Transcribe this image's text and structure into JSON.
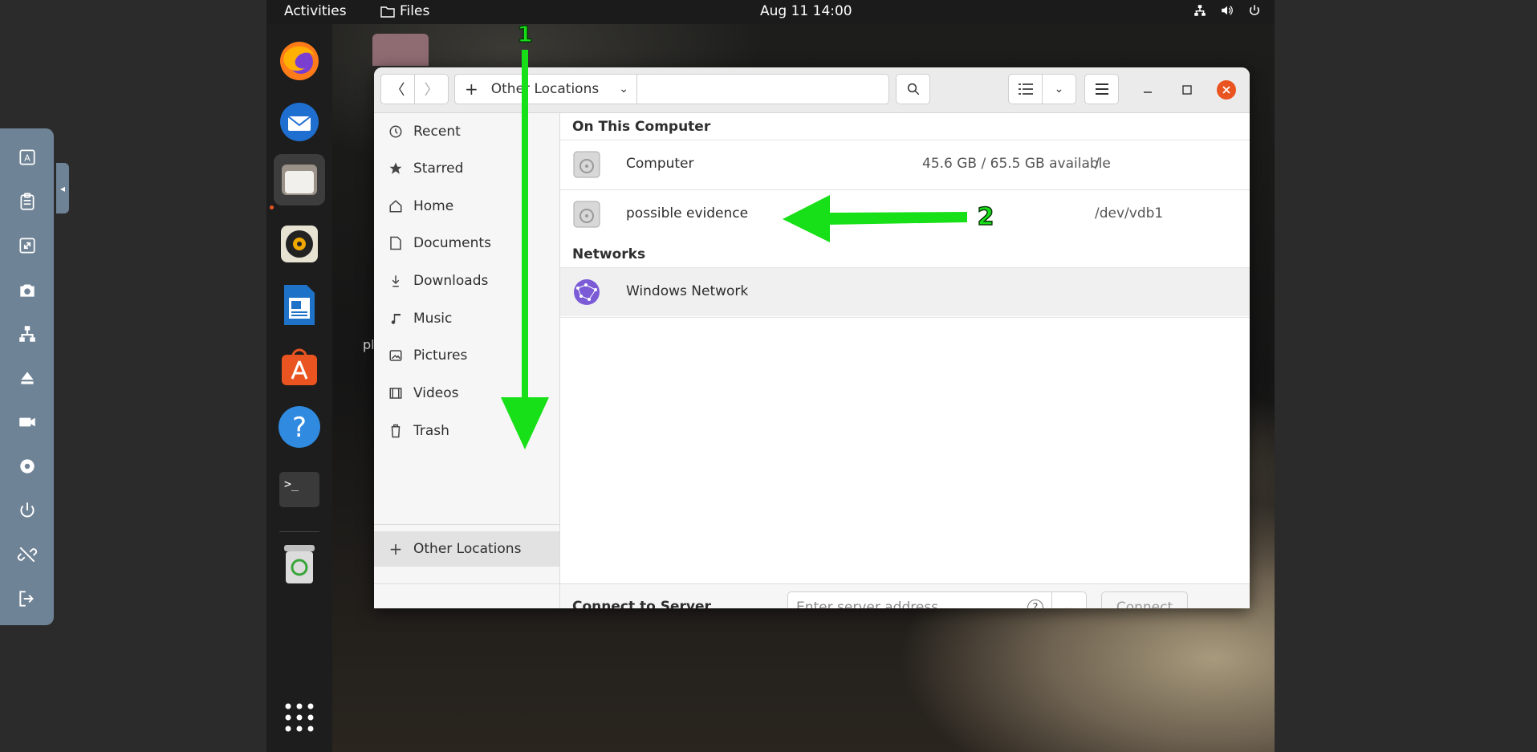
{
  "topbar": {
    "activities": "Activities",
    "app_name": "Files",
    "clock": "Aug 11  14:00"
  },
  "window": {
    "path_label": "Other Locations"
  },
  "sidebar": {
    "items": [
      {
        "label": "Recent",
        "icon": "clock-icon"
      },
      {
        "label": "Starred",
        "icon": "star-icon"
      },
      {
        "label": "Home",
        "icon": "home-icon"
      },
      {
        "label": "Documents",
        "icon": "document-icon"
      },
      {
        "label": "Downloads",
        "icon": "download-icon"
      },
      {
        "label": "Music",
        "icon": "music-icon"
      },
      {
        "label": "Pictures",
        "icon": "picture-icon"
      },
      {
        "label": "Videos",
        "icon": "video-icon"
      },
      {
        "label": "Trash",
        "icon": "trash-icon"
      }
    ],
    "other_locations": "Other Locations"
  },
  "content": {
    "on_this_computer": "On This Computer",
    "networks": "Networks",
    "locations": [
      {
        "name": "Computer",
        "available": "45.6 GB / 65.5 GB available",
        "mount": "/"
      },
      {
        "name": "possible evidence",
        "available": "",
        "mount": "/dev/vdb1"
      }
    ],
    "network_items": [
      {
        "name": "Windows Network"
      }
    ]
  },
  "footer": {
    "label": "Connect to Server",
    "placeholder": "Enter server address...",
    "help": "?",
    "connect": "Connect"
  },
  "annotations": {
    "label_1": "1",
    "label_2": "2",
    "color": "#18e018"
  },
  "desktop": {
    "partial_text": "pl"
  }
}
